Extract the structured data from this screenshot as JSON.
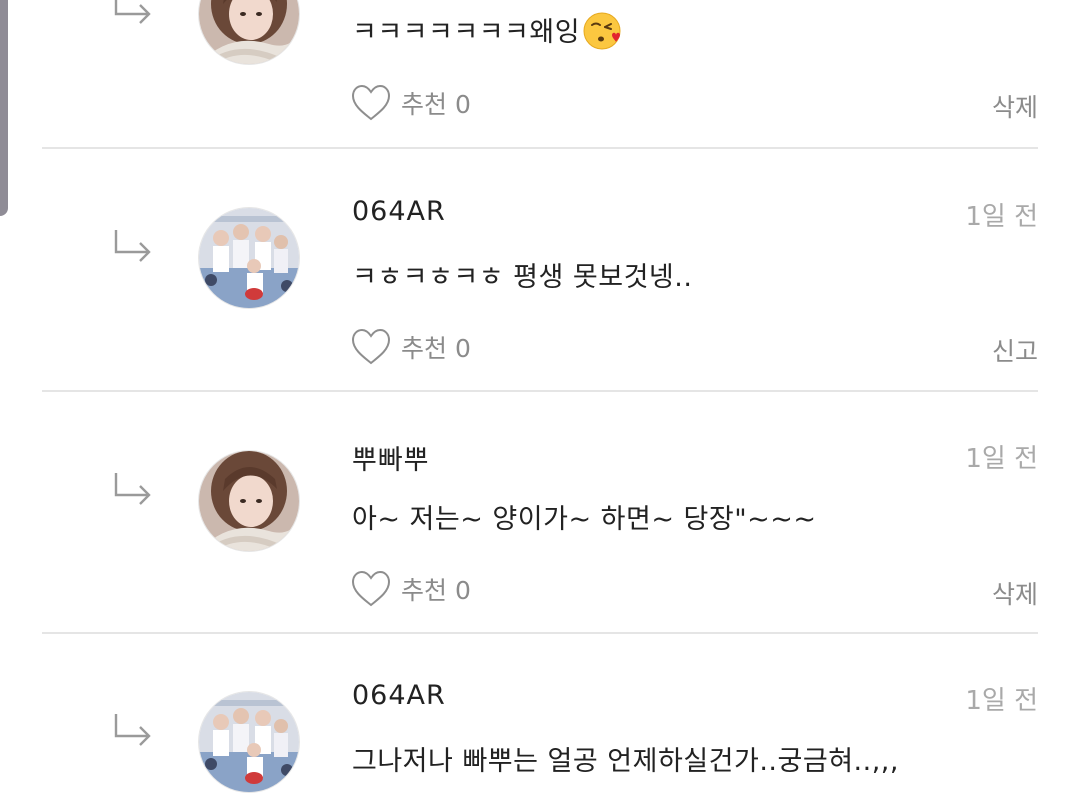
{
  "comments": [
    {
      "author": "",
      "time": "",
      "text": "ㅋㅋㅋㅋㅋㅋㅋ왜잉",
      "emoji": "kissing-face-heart-icon",
      "like_label": "추천 0",
      "action_label": "삭제",
      "avatar": "avatar-girl"
    },
    {
      "author": "064AR",
      "time": "1일 전",
      "text": "ㅋㅎㅋㅎㅋㅎ 평생 못보것넹..",
      "like_label": "추천 0",
      "action_label": "신고",
      "avatar": "avatar-group"
    },
    {
      "author": "뿌빠뿌",
      "time": "1일 전",
      "text": "아~ 저는~ 양이가~ 하면~ 당장\"~~~",
      "like_label": "추천 0",
      "action_label": "삭제",
      "avatar": "avatar-girl"
    },
    {
      "author": "064AR",
      "time": "1일 전",
      "text": "그나저나 빠뿌는 얼공 언제하실건가..궁금혀..,,,",
      "avatar": "avatar-group"
    }
  ],
  "colors": {
    "text": "#222222",
    "muted": "#8b8b8b",
    "time": "#a9a9a9",
    "divider": "#e5e5e5",
    "scroll_indicator": "#8f8c96"
  }
}
